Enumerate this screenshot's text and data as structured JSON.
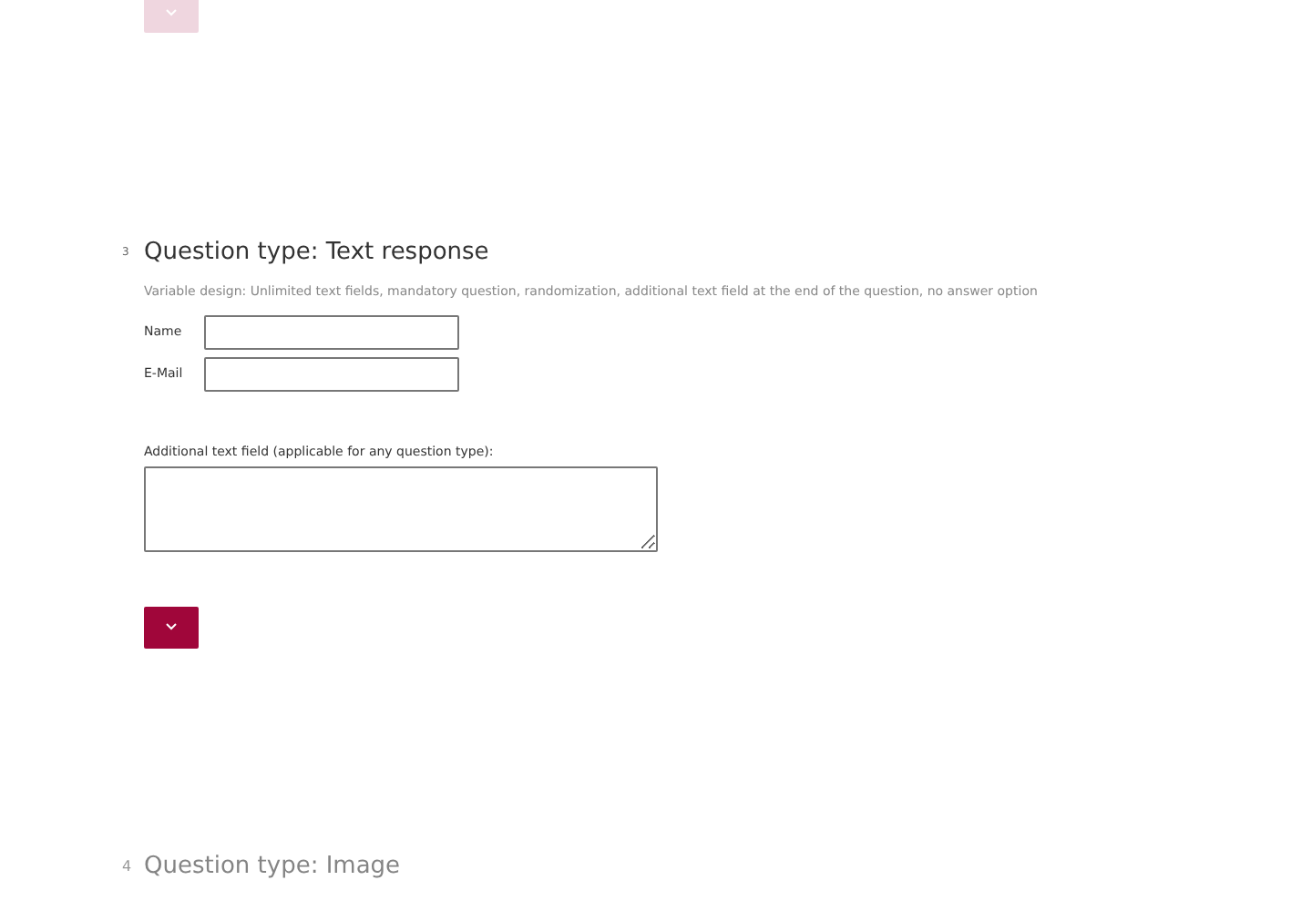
{
  "questions": [
    {
      "active": false
    },
    {
      "active": true,
      "number": "3",
      "title": "Question type: Text response",
      "description": "Variable design: Unlimited text fields, mandatory question, randomization, additional text field at the end of the question, no answer option",
      "fields": [
        {
          "label": "Name"
        },
        {
          "label": "E-Mail"
        }
      ],
      "additional_label": "Additional text field (applicable for any question type):"
    },
    {
      "active": false,
      "number": "4",
      "title": "Question type: Image"
    }
  ]
}
